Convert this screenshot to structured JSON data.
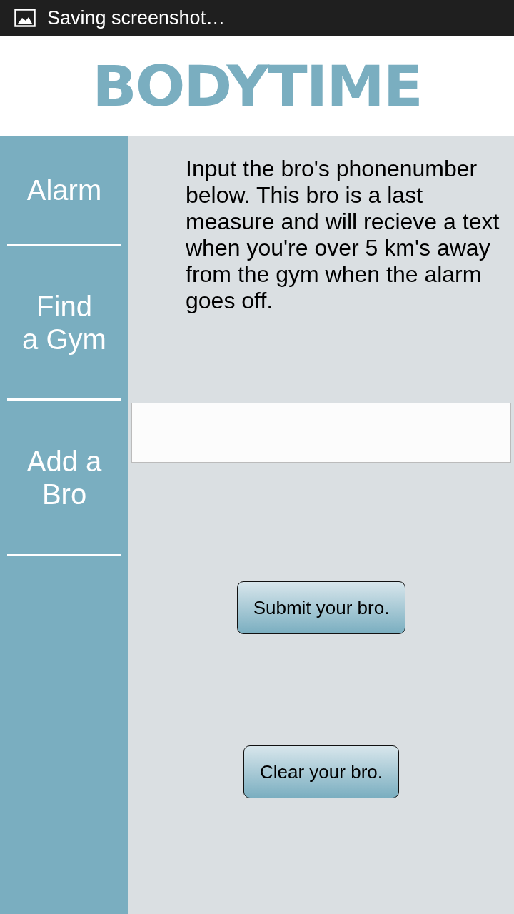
{
  "status_bar": {
    "text": "Saving screenshot…"
  },
  "logo": {
    "text": "BODYTIME"
  },
  "sidebar": {
    "items": [
      {
        "label": "Alarm"
      },
      {
        "label": "Find\na Gym"
      },
      {
        "label": "Add a\nBro"
      }
    ]
  },
  "instructions": "Input the bro's phonenumber below. This bro is a last measure and will recieve a text when you're over 5 km's away from the gym when the alarm goes off.",
  "buttons": [
    "Submit your bro.",
    "Clear your bro."
  ]
}
